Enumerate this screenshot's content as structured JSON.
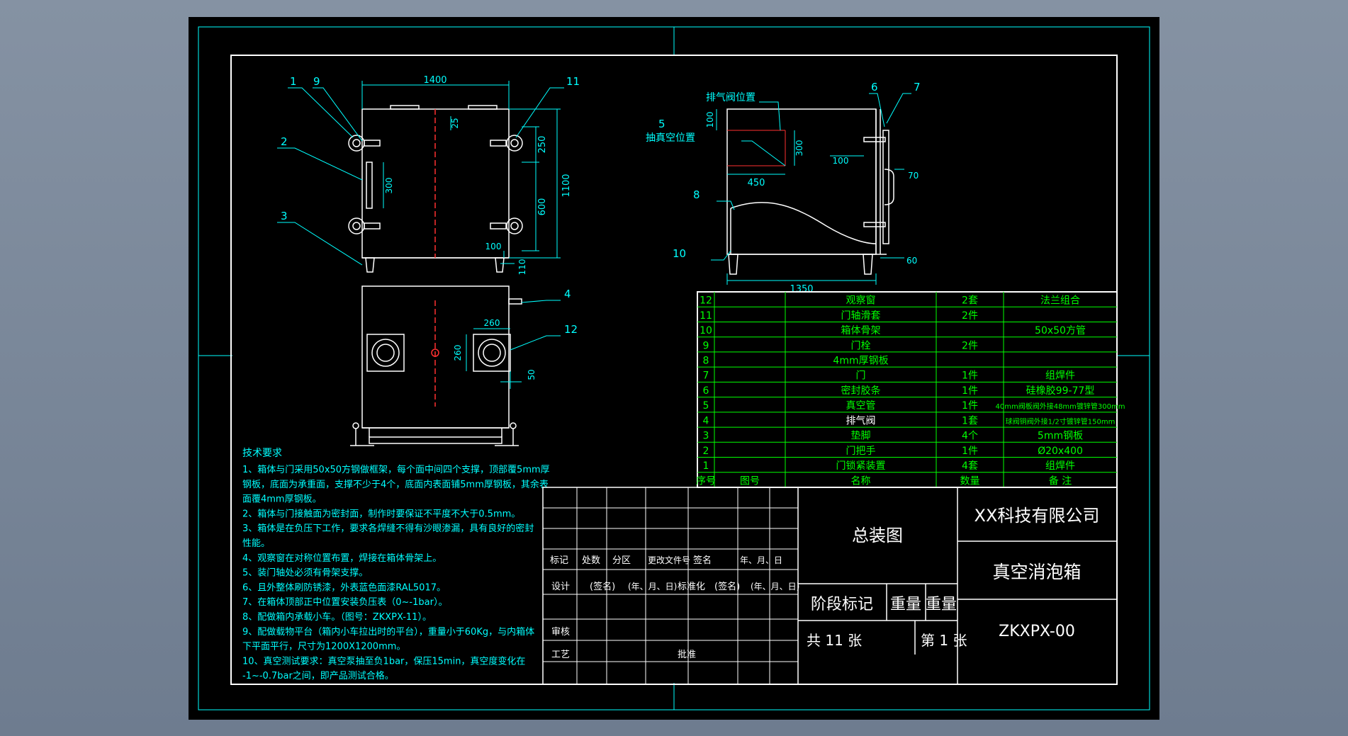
{
  "colors": {
    "background": "#7d8b9c",
    "sheet": "#000000",
    "frame": "#ffffff",
    "dimension": "#00ffff",
    "table": "#00ff00",
    "text": "#ffffff"
  },
  "dimensions": {
    "width_1400": "1400",
    "height_1100": "1100",
    "d_250": "250",
    "d_600": "600",
    "d_25": "25",
    "d_300_front": "300",
    "d_100_front": "100",
    "d_110": "110",
    "d_260_w": "260",
    "d_260_h": "260",
    "d_50": "50",
    "side_100_top": "100",
    "side_300": "300",
    "side_450": "450",
    "side_100": "100",
    "side_70": "70",
    "side_60": "60",
    "side_1350": "1350"
  },
  "callouts": {
    "c1": "1",
    "c2": "2",
    "c3": "3",
    "c4": "4",
    "c5": "5",
    "c6": "6",
    "c7": "7",
    "c8": "8",
    "c9": "9",
    "c10": "10",
    "c11": "11",
    "c12": "12"
  },
  "annotations": {
    "exhaust_valve": "排气阀位置",
    "vacuum_port": "抽真空位置"
  },
  "bom": {
    "rows": [
      {
        "no": "12",
        "code": "",
        "name": "观察窗",
        "qty": "2套",
        "note": "法兰组合"
      },
      {
        "no": "11",
        "code": "",
        "name": "门轴滑套",
        "qty": "2件",
        "note": ""
      },
      {
        "no": "10",
        "code": "",
        "name": "箱体骨架",
        "qty": "",
        "note": "50x50方管"
      },
      {
        "no": "9",
        "code": "",
        "name": "门栓",
        "qty": "2件",
        "note": ""
      },
      {
        "no": "8",
        "code": "",
        "name": "4mm厚钢板",
        "qty": "",
        "note": ""
      },
      {
        "no": "7",
        "code": "",
        "name": "门",
        "qty": "1件",
        "note": "组焊件"
      },
      {
        "no": "6",
        "code": "",
        "name": "密封胶条",
        "qty": "1件",
        "note": "硅橡胶99-77型"
      },
      {
        "no": "5",
        "code": "",
        "name": "真空管",
        "qty": "1件",
        "note": "40mm阀板阀外接48mm镀锌管300mm"
      },
      {
        "no": "4",
        "code": "",
        "name": "排气阀",
        "qty": "1套",
        "note": "球阀铜阀外接1/2寸镀锌管150mm"
      },
      {
        "no": "3",
        "code": "",
        "name": "垫脚",
        "qty": "4个",
        "note": "5mm钢板"
      },
      {
        "no": "2",
        "code": "",
        "name": "门把手",
        "qty": "1件",
        "note": "Ø20x400"
      },
      {
        "no": "1",
        "code": "",
        "name": "门锁紧装置",
        "qty": "4套",
        "note": "组焊件"
      }
    ],
    "header": {
      "no": "序号",
      "code": "图号",
      "name": "名称",
      "qty": "数量",
      "note": "备 注"
    }
  },
  "requirements": {
    "title": "技术要求",
    "lines": [
      "1、箱体与门采用50x50方钢做框架，每个面中间四个支撑，顶部覆5mm厚",
      "钢板，底面为承重面，支撑不少于4个，底面内表面铺5mm厚钢板，其余表",
      "面覆4mm厚钢板。",
      "2、箱体与门接触面为密封面，制作时要保证不平度不大于0.5mm。",
      "3、箱体是在负压下工作，要求各焊缝不得有沙眼渗漏，具有良好的密封",
      "性能。",
      "4、观察窗在对称位置布置，焊接在箱体骨架上。",
      "5、装门轴处必须有骨架支撑。",
      "6、且外整体刷防锈漆，外表蓝色面漆RAL5017。",
      "7、在箱体顶部正中位置安装负压表（0~-1bar）。",
      "8、配做箱内承载小车。（图号：ZKXPX-11）。",
      "9、配做载物平台（箱内小车拉出时的平台），重量小于60Kg，与内箱体",
      "下平面平行，尺寸为1200X1200mm。",
      "10、真空测试要求：真空泵抽至负1bar，保压15min，真空度变化在",
      "-1~-0.7bar之间，即产品测试合格。"
    ]
  },
  "title_block": {
    "row_mark": [
      "标记",
      "处数",
      "分区",
      "更改文件号",
      "签名",
      "年、月、日"
    ],
    "design": "设计",
    "sign1": "(签名)",
    "date1": "(年、月、日)",
    "standard": "标准化",
    "sign2": "(签名)",
    "date2": "(年、月、日)",
    "review": "审核",
    "process": "工艺",
    "approve": "批准",
    "drawing_type": "总装图",
    "stage": "阶段标记",
    "weight": "重量",
    "scale": "重量",
    "sheet_total": "共 11 张",
    "sheet_no": "第 1 张",
    "company": "XX科技有限公司",
    "product": "真空消泡箱",
    "drawing_no": "ZKXPX-00"
  }
}
